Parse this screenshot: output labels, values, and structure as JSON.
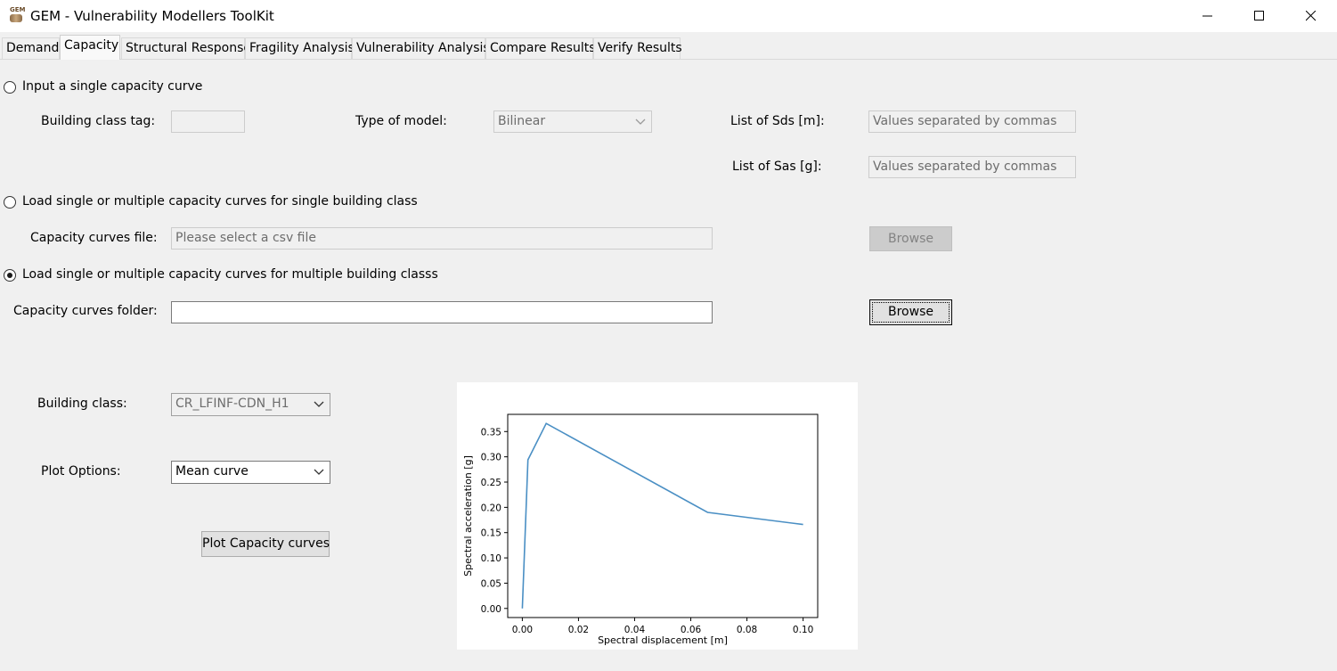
{
  "window": {
    "title": "GEM - Vulnerability Modellers ToolKit",
    "icon_text": "GEM"
  },
  "tabs": [
    {
      "label": "Demand"
    },
    {
      "label": "Capacity",
      "active": true
    },
    {
      "label": "Structural Response"
    },
    {
      "label": "Fragility Analysis"
    },
    {
      "label": "Vulnerability Analysis"
    },
    {
      "label": "Compare Results"
    },
    {
      "label": "Verify Results"
    }
  ],
  "section1": {
    "radio_label": "Input a single capacity curve",
    "selected": false,
    "building_class_tag_label": "Building class tag:",
    "building_class_tag_value": "",
    "type_of_model_label": "Type of model:",
    "type_of_model_value": "Bilinear",
    "sds_label": "List of Sds [m]:",
    "sds_placeholder": "Values separated by commas",
    "sas_label": "List of Sas [g]:",
    "sas_placeholder": "Values separated by commas"
  },
  "section2": {
    "radio_label": "Load single or multiple capacity curves for single building class",
    "selected": false,
    "file_label": "Capacity curves file:",
    "file_placeholder": "Please select a csv file",
    "browse_label": "Browse"
  },
  "section3": {
    "radio_label": "Load single or multiple capacity curves for multiple building classs",
    "selected": true,
    "folder_label": "Capacity curves folder:",
    "folder_value": "",
    "browse_label": "Browse"
  },
  "plot_panel": {
    "building_class_label": "Building class:",
    "building_class_value": "CR_LFINF-CDN_H1",
    "plot_options_label": "Plot Options:",
    "plot_options_value": "Mean curve",
    "plot_button_label": "Plot Capacity curves"
  },
  "colors": {
    "line": "#4a8fc4",
    "background": "#f0f0f0"
  },
  "chart_data": {
    "type": "line",
    "xlabel": "Spectral displacement [m]",
    "ylabel": "Spectral acceleration [g]",
    "xlim": [
      -0.0052,
      0.1052
    ],
    "ylim": [
      -0.018,
      0.384
    ],
    "xticks": [
      "0.00",
      "0.02",
      "0.04",
      "0.06",
      "0.08",
      "0.10"
    ],
    "yticks": [
      "0.00",
      "0.05",
      "0.10",
      "0.15",
      "0.20",
      "0.25",
      "0.30",
      "0.35"
    ],
    "grid": false,
    "series": [
      {
        "x": [
          0.0,
          0.002,
          0.0085,
          0.066,
          0.1
        ],
        "y": [
          0.0,
          0.294,
          0.366,
          0.19,
          0.166
        ]
      }
    ]
  }
}
